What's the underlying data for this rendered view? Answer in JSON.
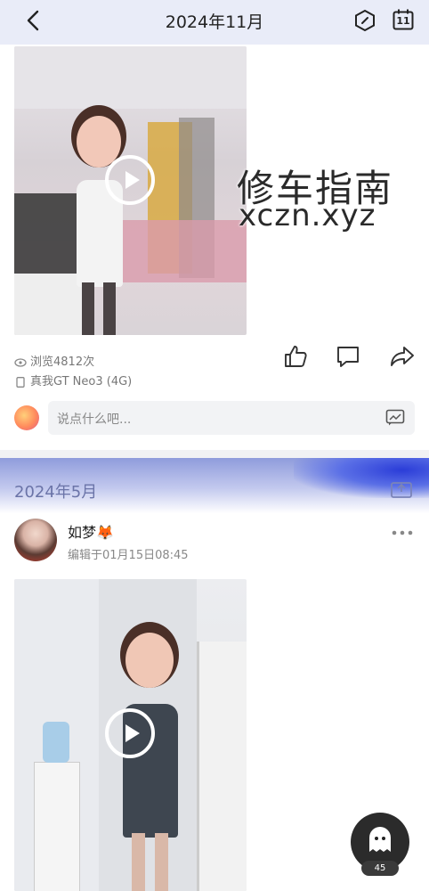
{
  "header": {
    "title": "2024年11月",
    "back_icon": "chevron-left-icon",
    "hex_icon": "hexagon-badge-icon",
    "calendar_icon": "calendar-icon",
    "calendar_day": "11"
  },
  "watermark": {
    "line1": "修车指南",
    "line2": "xczn.xyz"
  },
  "post1": {
    "views": "浏览4812次",
    "device": "真我GT Neo3 (4G)",
    "actions": [
      "like-icon",
      "comment-icon",
      "share-icon"
    ]
  },
  "comment_box": {
    "placeholder": "说点什么吧..."
  },
  "month_section": {
    "title": "2024年5月"
  },
  "post2": {
    "author": "如梦🦊",
    "edited": "编辑于01月15日08:45",
    "more_label": "•••"
  },
  "fab": {
    "badge": "45"
  },
  "colors": {
    "header_bg": "#e9ecf8",
    "banner_text": "#6b74a8",
    "accent": "#2b3dd8"
  }
}
